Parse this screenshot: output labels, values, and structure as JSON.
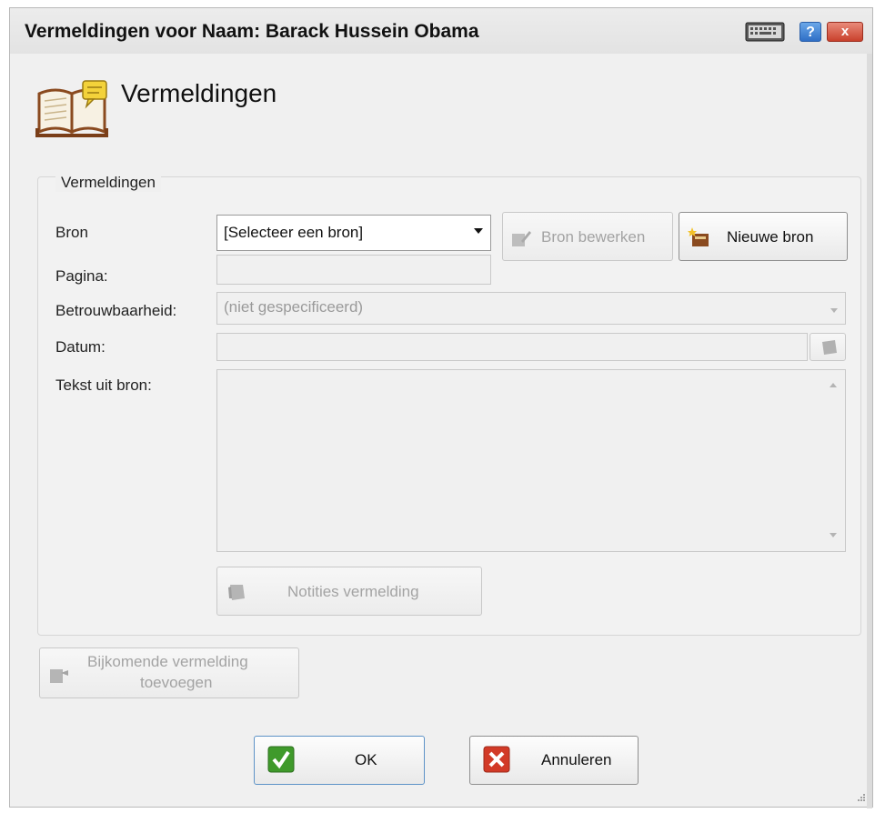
{
  "window": {
    "title": "Vermeldingen voor Naam: Barack Hussein Obama",
    "help_label": "?",
    "close_label": "x"
  },
  "header": {
    "title": "Vermeldingen"
  },
  "group": {
    "legend": "Vermeldingen",
    "labels": {
      "bron": "Bron",
      "pagina": "Pagina:",
      "betrouwbaarheid": "Betrouwbaarheid:",
      "datum": "Datum:",
      "tekst": "Tekst uit bron:"
    },
    "bron_select": {
      "value": "[Selecteer een bron]"
    },
    "pagina_value": "",
    "betrouwbaarheid_value": "(niet gespecificeerd)",
    "datum_value": "",
    "tekst_value": "",
    "buttons": {
      "bron_bewerken": "Bron bewerken",
      "nieuwe_bron": "Nieuwe bron",
      "notities": "Notities vermelding"
    }
  },
  "extra_button": {
    "line1": "Bijkomende vermelding",
    "line2": "toevoegen"
  },
  "footer": {
    "ok": "OK",
    "cancel": "Annuleren"
  },
  "colors": {
    "ok_green": "#3f9a2b",
    "cancel_red": "#d23a27",
    "title_blue": "#2f6fc6",
    "book_brown": "#8a4a1f",
    "note_yellow": "#f3d23a"
  }
}
